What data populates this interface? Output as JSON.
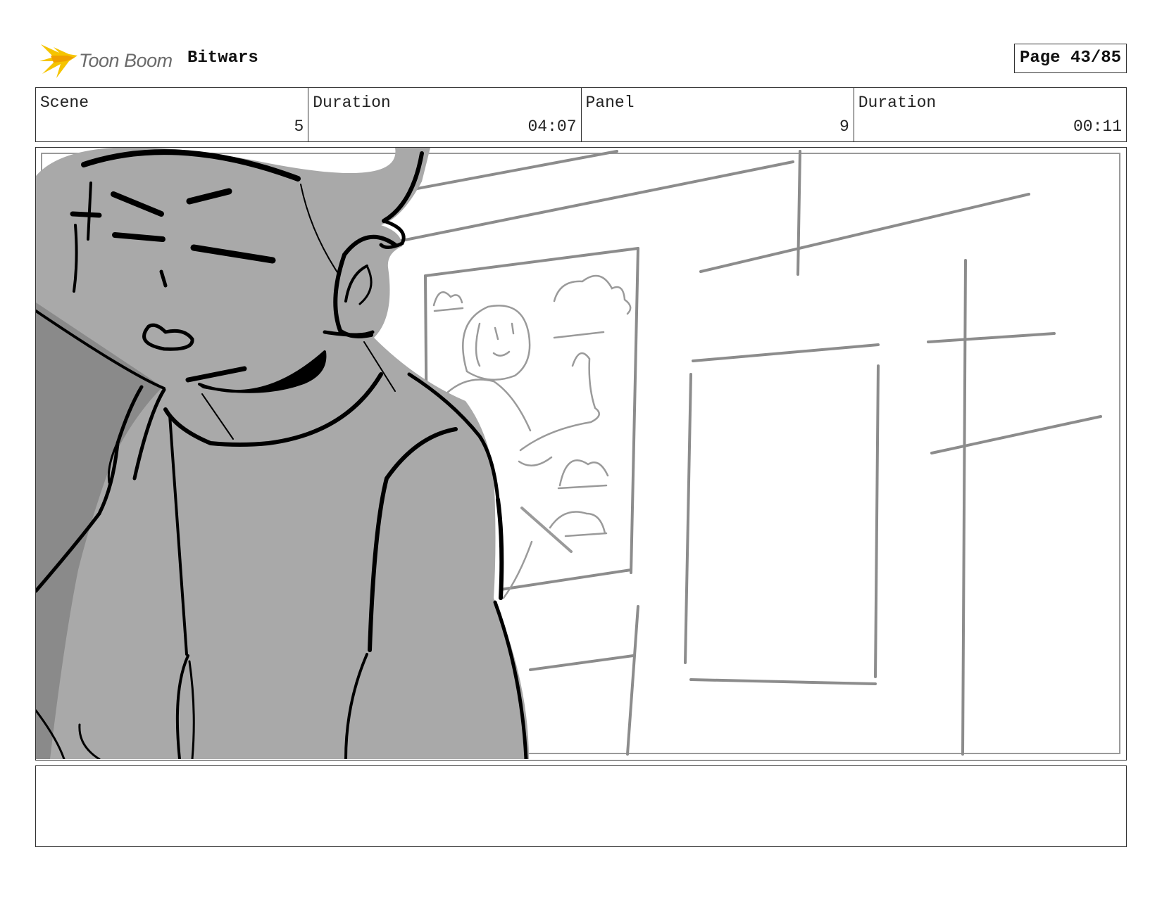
{
  "header": {
    "logo_text": "Toon Boom",
    "project_title": "Bitwars",
    "page_label": "Page 43/85"
  },
  "info": {
    "scene_label": "Scene",
    "scene_value": "5",
    "scene_duration_label": "Duration",
    "scene_duration_value": "04:07",
    "panel_label": "Panel",
    "panel_value": "9",
    "panel_duration_label": "Duration",
    "panel_duration_value": "00:11"
  },
  "colors": {
    "logo_accent": "#f5c400",
    "character_fill": "#a9a9a9",
    "sketch_lines": "#8c8c8c"
  },
  "notes": {
    "text": ""
  }
}
